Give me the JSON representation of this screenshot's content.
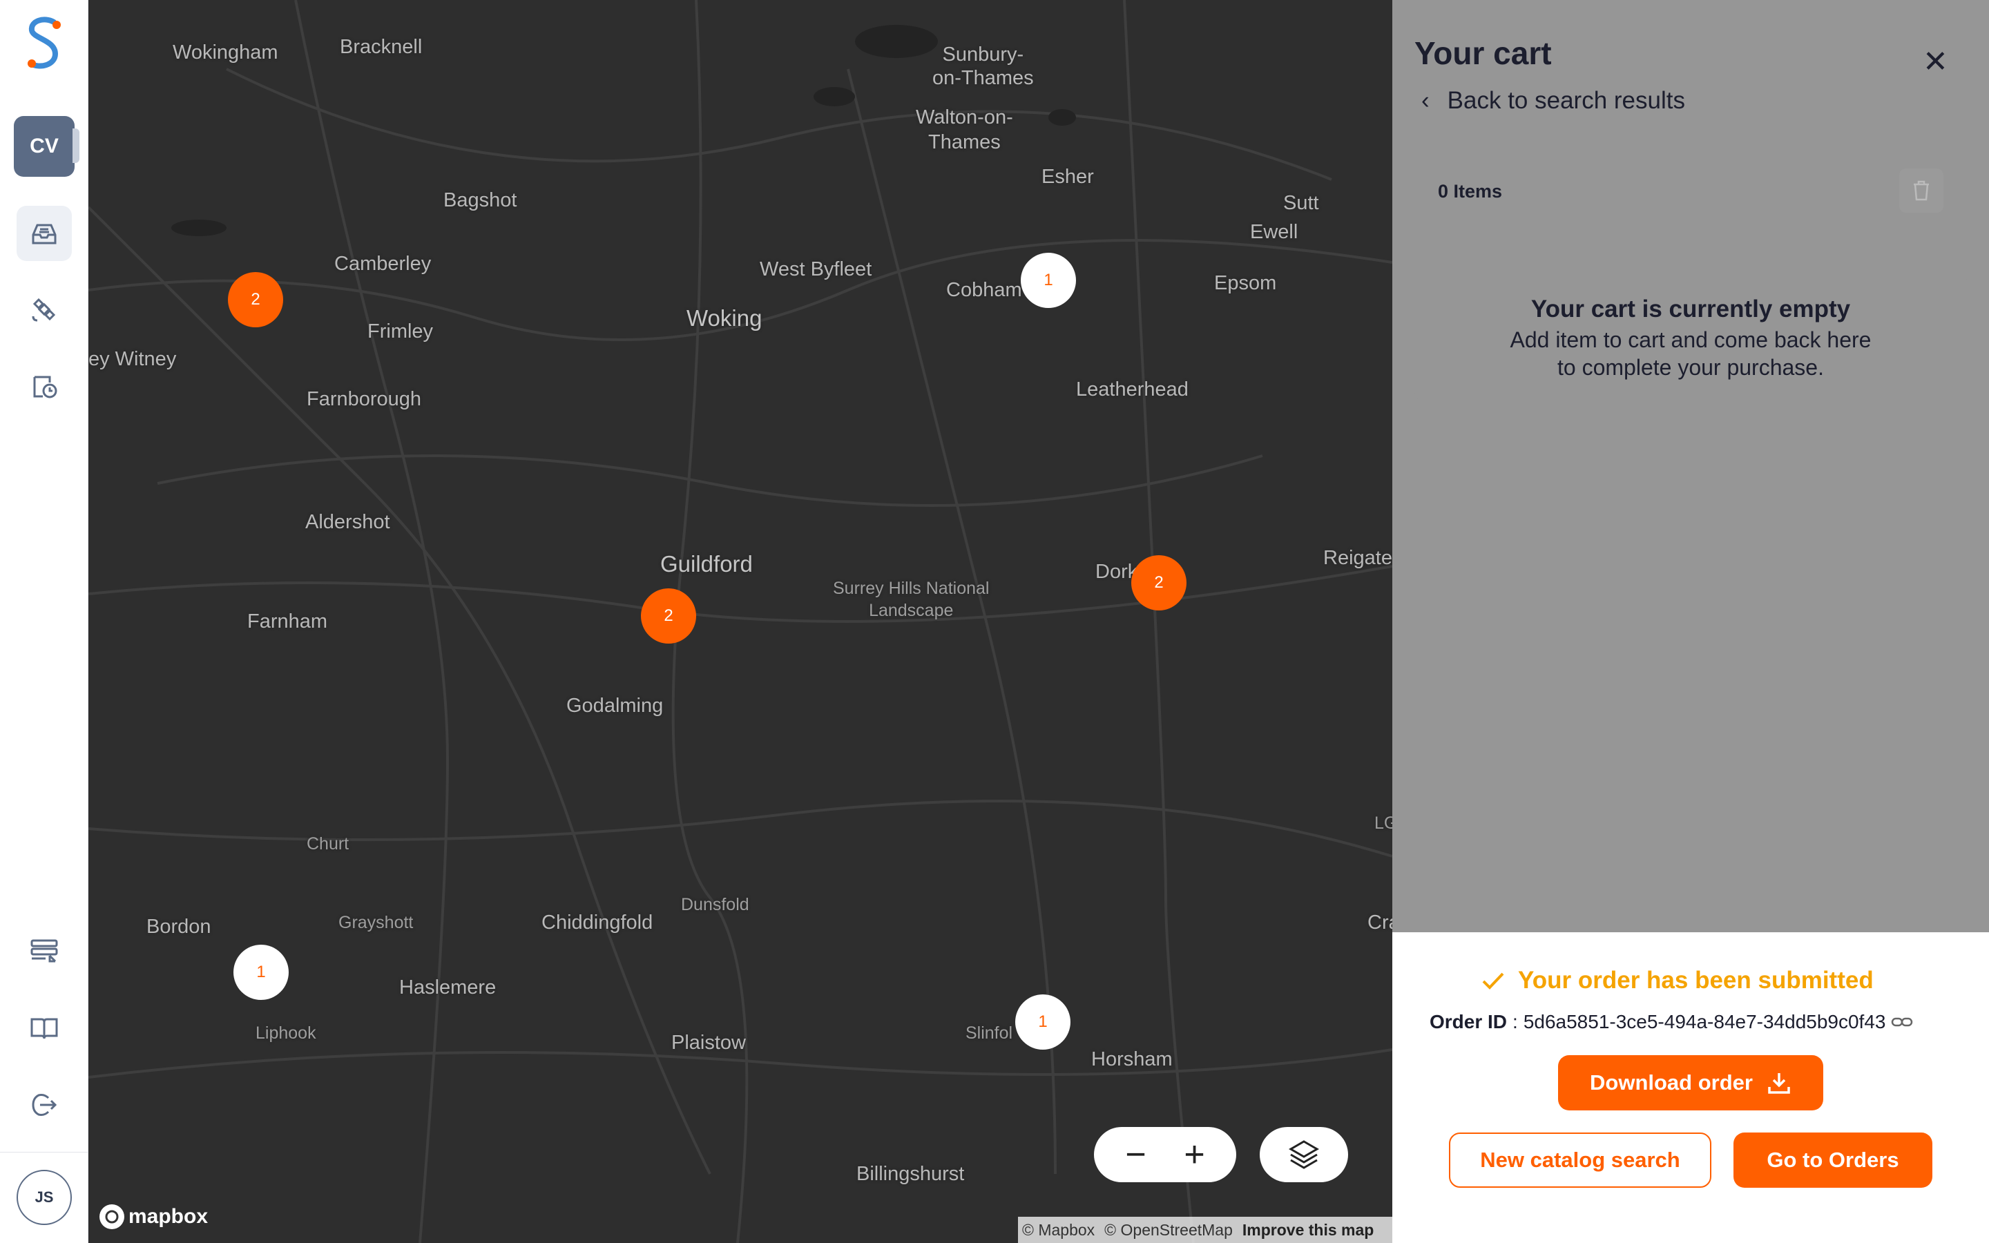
{
  "sidebar": {
    "workspace_avatar": "CV",
    "user_avatar": "JS",
    "nav_icons": [
      "inbox-icon",
      "satellite-icon",
      "history-icon",
      "tasks-icon",
      "docs-book-icon",
      "logout-icon"
    ]
  },
  "map": {
    "labels": {
      "wokingham": "Wokingham",
      "bracknell": "Bracknell",
      "sunbury": "Sunbury-\non-Thames",
      "walton": "Walton-on-\nThames",
      "esher": "Esher",
      "sutton": "Sutt",
      "ewell": "Ewell",
      "epsom": "Epsom",
      "bagshot": "Bagshot",
      "camberley": "Camberley",
      "west_byfleet": "West Byfleet",
      "cobham": "Cobham",
      "woking": "Woking",
      "frimley": "Frimley",
      "witney": "ey Witney",
      "farnborough": "Farnborough",
      "leatherhead": "Leatherhead",
      "aldershot": "Aldershot",
      "guildford": "Guildford",
      "surrey_hills": "Surrey Hills National\nLandscape",
      "dorking": "Dork",
      "reigate": "Reigate",
      "farnham": "Farnham",
      "godalming": "Godalming",
      "churt": "Churt",
      "dunsfold": "Dunsfold",
      "bordon": "Bordon",
      "grayshott": "Grayshott",
      "chiddingfold": "Chiddingfold",
      "haslemere": "Haslemere",
      "liphook": "Liphook",
      "plaistow": "Plaistow",
      "slinfold": "Slinfol",
      "horsham": "Horsham",
      "billingshurst": "Billingshurst",
      "crawley": "Cra",
      "lgw": "LG"
    },
    "clusters": {
      "c1": "2",
      "c2": "1",
      "c3": "2",
      "c4": "2",
      "c5": "1",
      "c6": "1"
    },
    "zoom_out": "−",
    "zoom_in": "+",
    "mapbox_brand": "mapbox",
    "attribution": {
      "mapbox": "© Mapbox",
      "osm": "© OpenStreetMap",
      "improve": "Improve this map"
    }
  },
  "cart": {
    "title": "Your cart",
    "back_label": "Back to search results",
    "items_count": "0 Items",
    "empty_title": "Your cart is currently empty",
    "empty_line1": "Add item to cart and come back here",
    "empty_line2": "to complete your purchase."
  },
  "order": {
    "success_message": "Your order has been submitted",
    "id_label": "Order ID",
    "id_value": "5d6a5851-3ce5-494a-84e7-34dd5b9c0f43",
    "download_label": "Download order",
    "new_search_label": "New catalog search",
    "go_orders_label": "Go to Orders"
  },
  "colors": {
    "brand_orange": "#ff5f00",
    "success_yellow": "#f5a300",
    "map_bg": "#2e2e2e"
  }
}
